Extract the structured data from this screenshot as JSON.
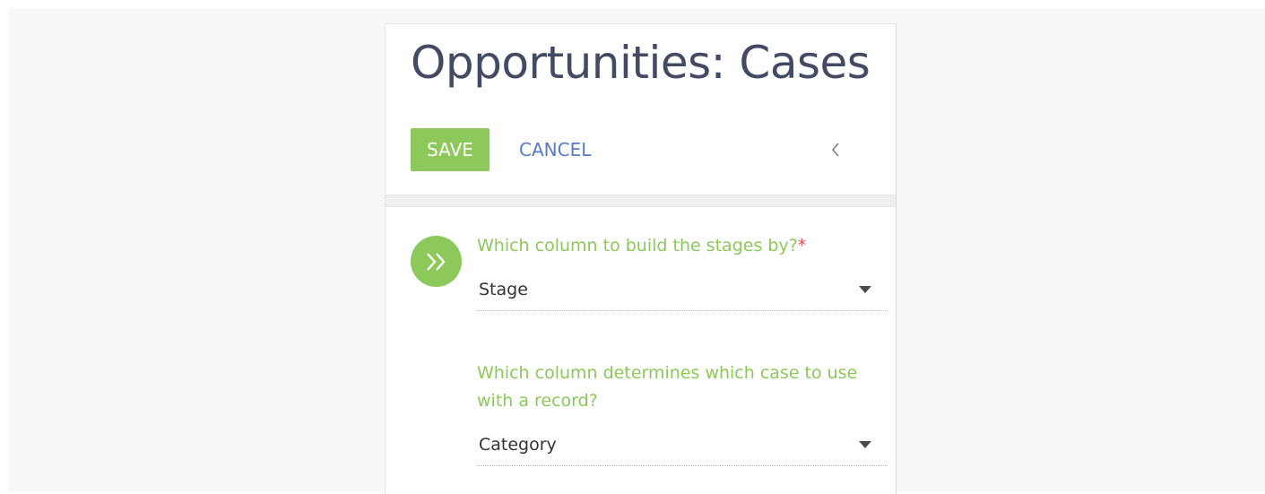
{
  "header": {
    "title": "Opportunities: Cases"
  },
  "toolbar": {
    "save_label": "SAVE",
    "cancel_label": "CANCEL",
    "collapse_icon": "chevron-left-icon"
  },
  "form": {
    "step_icon": "double-chevron-right-icon",
    "fields": [
      {
        "label": "Which column to build the stages by?",
        "required_mark": "*",
        "value": "Stage"
      },
      {
        "label": "Which column determines which case to use with a record?",
        "value": "Category"
      }
    ]
  },
  "colors": {
    "accent_green": "#8cc85a",
    "link_blue": "#5a79c8",
    "title_text": "#434a63",
    "required_red": "#e25454"
  }
}
